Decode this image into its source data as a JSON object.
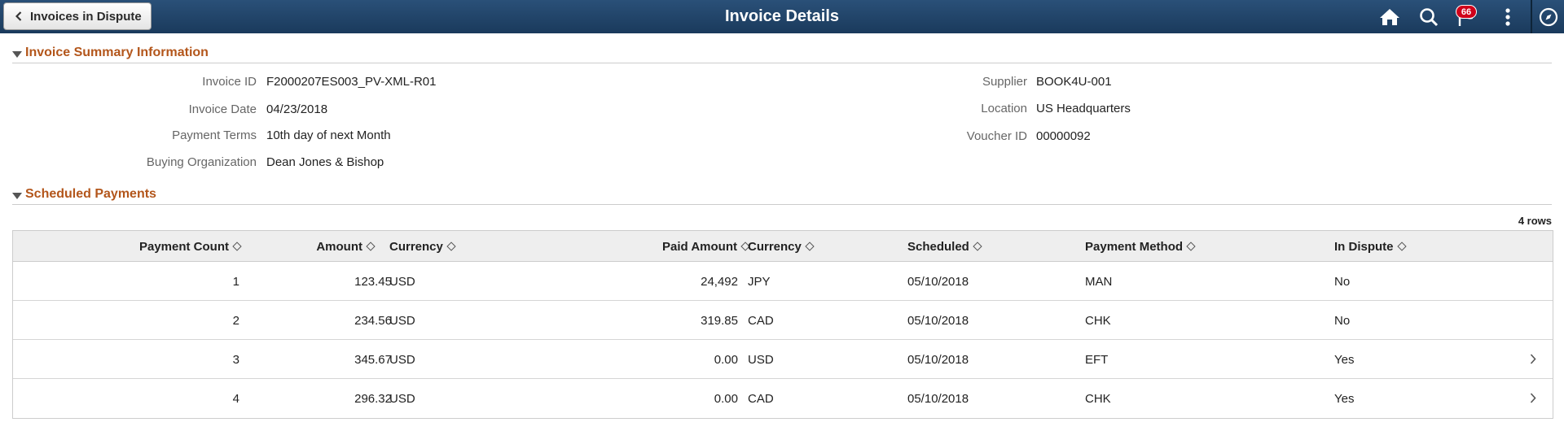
{
  "header": {
    "back_label": "Invoices in Dispute",
    "title": "Invoice Details",
    "notification_count": "66",
    "icons": [
      "chevron-left-icon",
      "home-icon",
      "search-icon",
      "notification-flag-icon",
      "actions-menu-icon",
      "navbar-compass-icon"
    ]
  },
  "summary": {
    "title": "Invoice Summary Information",
    "left": [
      {
        "label": "Invoice ID",
        "value": "F2000207ES003_PV-XML-R01"
      },
      {
        "label": "Invoice Date",
        "value": "04/23/2018"
      },
      {
        "label": "Payment Terms",
        "value": "10th day of next Month"
      },
      {
        "label": "Buying Organization",
        "value": "Dean Jones & Bishop"
      }
    ],
    "right": [
      {
        "label": "Supplier",
        "value": "BOOK4U-001"
      },
      {
        "label": "Location",
        "value": "US Headquarters"
      },
      {
        "label": "Voucher ID",
        "value": "00000092"
      }
    ]
  },
  "payments": {
    "title": "Scheduled Payments",
    "row_count": "4 rows",
    "columns": [
      "Payment Count",
      "Amount",
      "Currency",
      "Paid Amount",
      "Currency",
      "Scheduled",
      "Payment Method",
      "In Dispute"
    ],
    "rows": [
      {
        "count": "1",
        "amount": "123.45",
        "currency": "USD",
        "paid": "24,492",
        "paid_currency": "JPY",
        "scheduled": "05/10/2018",
        "method": "MAN",
        "dispute": "No",
        "has_detail": false
      },
      {
        "count": "2",
        "amount": "234.56",
        "currency": "USD",
        "paid": "319.85",
        "paid_currency": "CAD",
        "scheduled": "05/10/2018",
        "method": "CHK",
        "dispute": "No",
        "has_detail": false
      },
      {
        "count": "3",
        "amount": "345.67",
        "currency": "USD",
        "paid": "0.00",
        "paid_currency": "USD",
        "scheduled": "05/10/2018",
        "method": "EFT",
        "dispute": "Yes",
        "has_detail": true
      },
      {
        "count": "4",
        "amount": "296.32",
        "currency": "USD",
        "paid": "0.00",
        "paid_currency": "CAD",
        "scheduled": "05/10/2018",
        "method": "CHK",
        "dispute": "Yes",
        "has_detail": true
      }
    ]
  },
  "colors": {
    "banner": "#1f4266",
    "section_title": "#b3561b",
    "badge": "#d0021b",
    "grid_header": "#eeeeee"
  }
}
